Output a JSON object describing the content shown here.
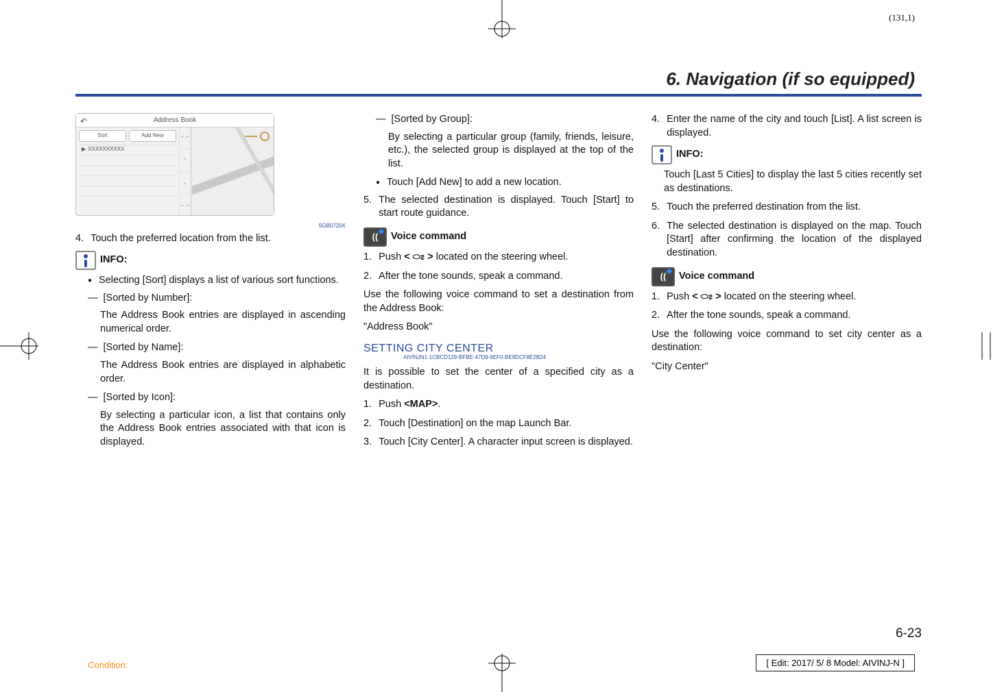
{
  "sheet": "(131,1)",
  "chapter_title": "6. Navigation (if so equipped)",
  "screenshot": {
    "title": "Address Book",
    "btn_sort": "Sort",
    "btn_addnew": "Add New",
    "row_text": "XXXXXXXXXX",
    "code": "5GB0720X"
  },
  "col1": {
    "step4": "Touch the preferred location from the list.",
    "info_label": "INFO:",
    "bullet1": "Selecting [Sort] displays a list of various sort functions.",
    "sort_number_h": "[Sorted by Number]:",
    "sort_number_b": "The Address Book entries are displayed in ascending numerical order.",
    "sort_name_h": "[Sorted by Name]:",
    "sort_name_b": "The Address Book entries are displayed in alphabetic order.",
    "sort_icon_h": "[Sorted by Icon]:",
    "sort_icon_b": "By selecting a particular icon, a list that contains only the Address Book entries associated with that icon is displayed."
  },
  "col2": {
    "sort_group_h": "[Sorted by Group]:",
    "sort_group_b": "By selecting a particular group (family, friends, leisure, etc.), the selected group is displayed at the top of the list.",
    "bullet_addnew": "Touch [Add New] to add a new location.",
    "step5": "The selected destination is displayed. Touch [Start] to start route guidance.",
    "voice_label": "Voice command",
    "vc1_a": "Push ",
    "vc1_b": " located on the steering wheel.",
    "vc2": "After the tone sounds, speak a command.",
    "use_following": "Use the following voice command to set a destination from the Address Book:",
    "cmd": "\"Address Book\"",
    "section": "SETTING CITY CENTER",
    "guid": "AIVINJN1-1CBCD129-BFBE-47D9-9EF0-BE9DCF8E2B24",
    "intro": "It is possible to set the center of a specified city as a destination.",
    "cc1_a": "Push ",
    "cc1_b": "<MAP>",
    "cc1_c": ".",
    "cc2": "Touch [Destination] on the map Launch Bar.",
    "cc3": "Touch [City Center]. A character input screen is displayed."
  },
  "col3": {
    "cc4": "Enter the name of the city and touch [List]. A list screen is displayed.",
    "info_label": "INFO:",
    "info_body": "Touch [Last 5 Cities] to display the last 5 cities recently set as destinations.",
    "cc5": "Touch the preferred destination from the list.",
    "cc6": "The selected destination is displayed on the map. Touch [Start] after confirming the location of the displayed destination.",
    "voice_label": "Voice command",
    "vc1_a": "Push ",
    "vc1_b": " located on the steering wheel.",
    "vc2": "After the tone sounds, speak a command.",
    "use_following": "Use the following voice command to set city center as a destination:",
    "cmd": "\"City Center\""
  },
  "page_number": "6-23",
  "condition": "Condition:",
  "edit_box": "[ Edit: 2017/ 5/ 8    Model:  AIVINJ-N ]",
  "glyphs": {
    "steer_open": "< ",
    "steer_close": " >",
    "steer_icon": "⬭ᴤ"
  }
}
